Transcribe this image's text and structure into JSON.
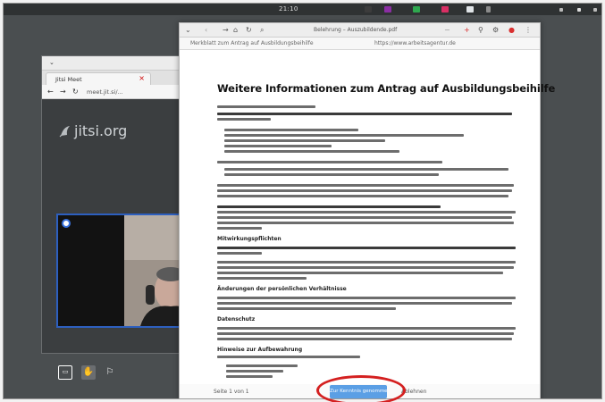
{
  "desktop": {
    "clock": "21:10"
  },
  "jitsi_window": {
    "tab_label": "Jitsi Meet",
    "url": "meet.jit.si/...",
    "logo_text": "jitsi.org"
  },
  "pdf_window": {
    "window_title": "Belehrung – Auszubildende.pdf",
    "header_left": "Merkblatt zum Antrag auf Ausbildungsbeihilfe",
    "header_right": "https://www.arbeitsagentur.de",
    "doc_title": "Weitere Informationen zum Antrag auf Ausbildungsbeihilfe",
    "headings": [
      "Mitwirkungspflichten",
      "Änderungen der persönlichen Verhältnisse",
      "Datenschutz",
      "Hinweise zur Aufbewahrung"
    ],
    "bottom_left": "Seite 1 von 1",
    "action_button": "Zur Kenntnis genommen",
    "bottom_right": "Ablehnen"
  },
  "colors": {
    "highlight_ring": "#d42020",
    "action_button": "#5b9fe5",
    "video_border": "#2d5fbf"
  }
}
